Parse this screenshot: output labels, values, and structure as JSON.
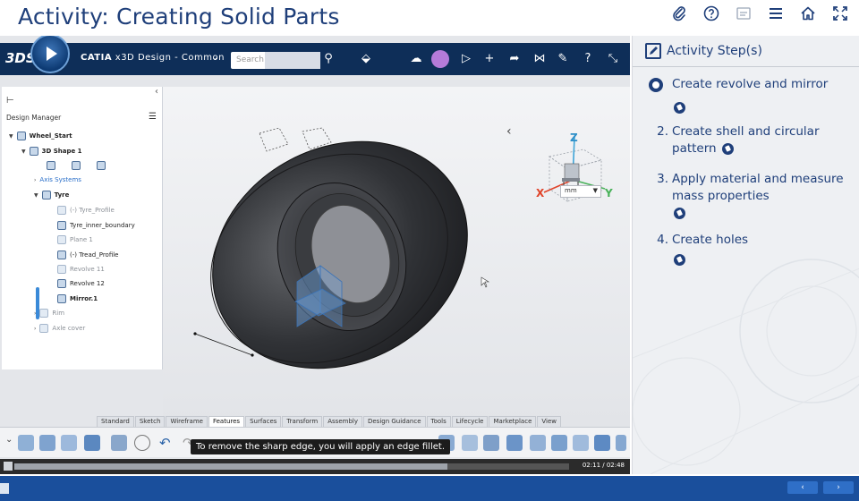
{
  "header": {
    "title": "Activity: Creating Solid Parts",
    "icons": [
      "paperclip-icon",
      "help-icon",
      "transcript-icon",
      "menu-icon",
      "home-icon",
      "fullscreen-icon"
    ]
  },
  "catia": {
    "brand": "3DS",
    "app_name_bold": "CATIA",
    "app_name_rest": "x3D Design - Common",
    "dropdown": "⌄",
    "search_placeholder": "Search"
  },
  "tree": {
    "panel_label": "Design Manager",
    "rows": [
      {
        "label": "Wheel_Start"
      },
      {
        "label": "3D Shape 1"
      },
      {
        "label": "Axis Systems"
      },
      {
        "label": "Tyre"
      },
      {
        "label": "(-) Tyre_Profile"
      },
      {
        "label": "Tyre_inner_boundary"
      },
      {
        "label": "Plane 1"
      },
      {
        "label": "(-) Tread_Profile"
      },
      {
        "label": "Revolve 11"
      },
      {
        "label": "Revolve 12"
      },
      {
        "label": "Mirror.1"
      },
      {
        "label": "Rim"
      },
      {
        "label": "Axle cover"
      }
    ]
  },
  "viewport": {
    "nav_chevron": "‹",
    "unit": "mm",
    "axis_x": "X",
    "axis_y": "Y",
    "axis_z": "Z"
  },
  "toolbar_tabs": [
    "Standard",
    "Sketch",
    "Wireframe",
    "Features",
    "Surfaces",
    "Transform",
    "Assembly",
    "Design Guidance",
    "Tools",
    "Lifecycle",
    "Marketplace",
    "View"
  ],
  "caption": "To remove the sharp edge, you will apply an edge fillet.",
  "player": {
    "time": "02:11 / 02:48",
    "progress": 0.78
  },
  "activity": {
    "heading": "Activity Step(s)",
    "steps": [
      {
        "num": "",
        "text": "Create revolve and mirror"
      },
      {
        "num": "2.",
        "text": "Create shell and circular pattern"
      },
      {
        "num": "3.",
        "text": "Apply material and measure mass properties"
      },
      {
        "num": "4.",
        "text": "Create holes"
      }
    ]
  },
  "footer": {
    "prev_label": "‹",
    "next_label": "›"
  },
  "colors": {
    "title": "#1f3f7a",
    "catia_bar": "#0e2e58",
    "footer": "#1a4f9c"
  }
}
